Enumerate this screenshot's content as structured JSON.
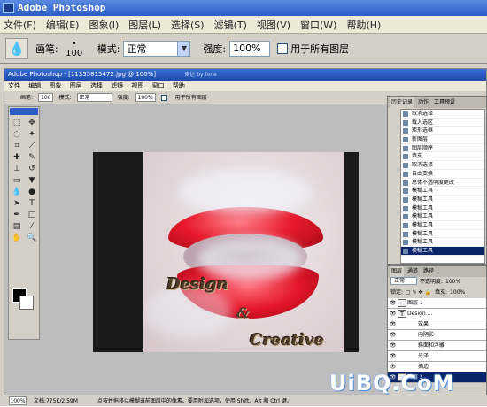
{
  "app": {
    "title": "Adobe Photoshop"
  },
  "menu": [
    "文件(F)",
    "编辑(E)",
    "图象(I)",
    "图层(L)",
    "选择(S)",
    "滤镜(T)",
    "视图(V)",
    "窗口(W)",
    "帮助(H)"
  ],
  "options": {
    "brush_label": "画笔:",
    "brush_size": "100",
    "mode_label": "模式:",
    "mode_value": "正常",
    "strength_label": "强度:",
    "strength_value": "100%",
    "all_layers_label": "用于所有图层"
  },
  "inner_window": {
    "title": "Adobe Photoshop - [11355815472.jpg @ 100%]",
    "watermark": "奋达 by fone",
    "menu": [
      "文件",
      "编辑",
      "图象",
      "图层",
      "选择",
      "滤镜",
      "视图",
      "窗口",
      "帮助"
    ],
    "opts": {
      "brush_label": "画笔:",
      "brush_size": "100",
      "mode_label": "模式:",
      "mode_value": "正常",
      "strength_label": "强度:",
      "strength_value": "100%",
      "all_layers_label": "用于所有图层"
    }
  },
  "canvas_text": {
    "line1": "Design",
    "amp": "&",
    "line2": "Creative"
  },
  "history": {
    "tabs": [
      "历史记录",
      "动作",
      "工具预设"
    ],
    "items": [
      "取消选择",
      "载入选区",
      "矩形选框",
      "新图层",
      "图层顺序",
      "填充",
      "取消选择",
      "自由变换",
      "总体不透明度更改",
      "模糊工具",
      "模糊工具",
      "模糊工具",
      "模糊工具",
      "模糊工具",
      "模糊工具",
      "模糊工具",
      "模糊工具"
    ]
  },
  "layers": {
    "tabs": [
      "图层",
      "通道",
      "路径"
    ],
    "blend": "正常",
    "opacity_label": "不透明度:",
    "opacity": "100%",
    "lock_label": "锁定:",
    "fill_label": "填充:",
    "fill": "100%",
    "rows": [
      "图层 1",
      "Design ...",
      "效果",
      "内阴影",
      "斜面和浮雕",
      "光泽",
      "描边",
      "图层 2"
    ]
  },
  "status": {
    "zoom": "100%",
    "doc": "文档:775K/2.59M",
    "hint": "点按并拖移以模糊当前图层中的像素。要用附加选项，使用 Shift、Alt 和 Ctrl 键。"
  },
  "watermark": "UiBQ.CoM",
  "colors": {
    "title_blue": "#2d5cc8",
    "lips_red": "#e4162a",
    "selected": "#0a246a"
  }
}
